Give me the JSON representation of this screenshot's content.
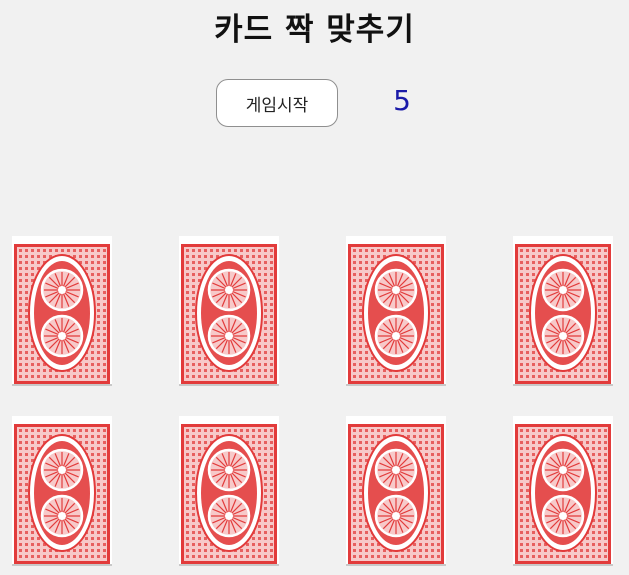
{
  "title": "카드 짝 맞추기",
  "controls": {
    "start_label": "게임시작",
    "counter": "5"
  },
  "cards": [
    {
      "face": "back"
    },
    {
      "face": "back"
    },
    {
      "face": "back"
    },
    {
      "face": "back"
    },
    {
      "face": "back"
    },
    {
      "face": "back"
    },
    {
      "face": "back"
    },
    {
      "face": "back"
    }
  ],
  "colors": {
    "card_back": "#e23b3b",
    "card_back_light": "#f7c9c9",
    "counter": "#1a1aa8",
    "background": "#f1f1f1"
  }
}
